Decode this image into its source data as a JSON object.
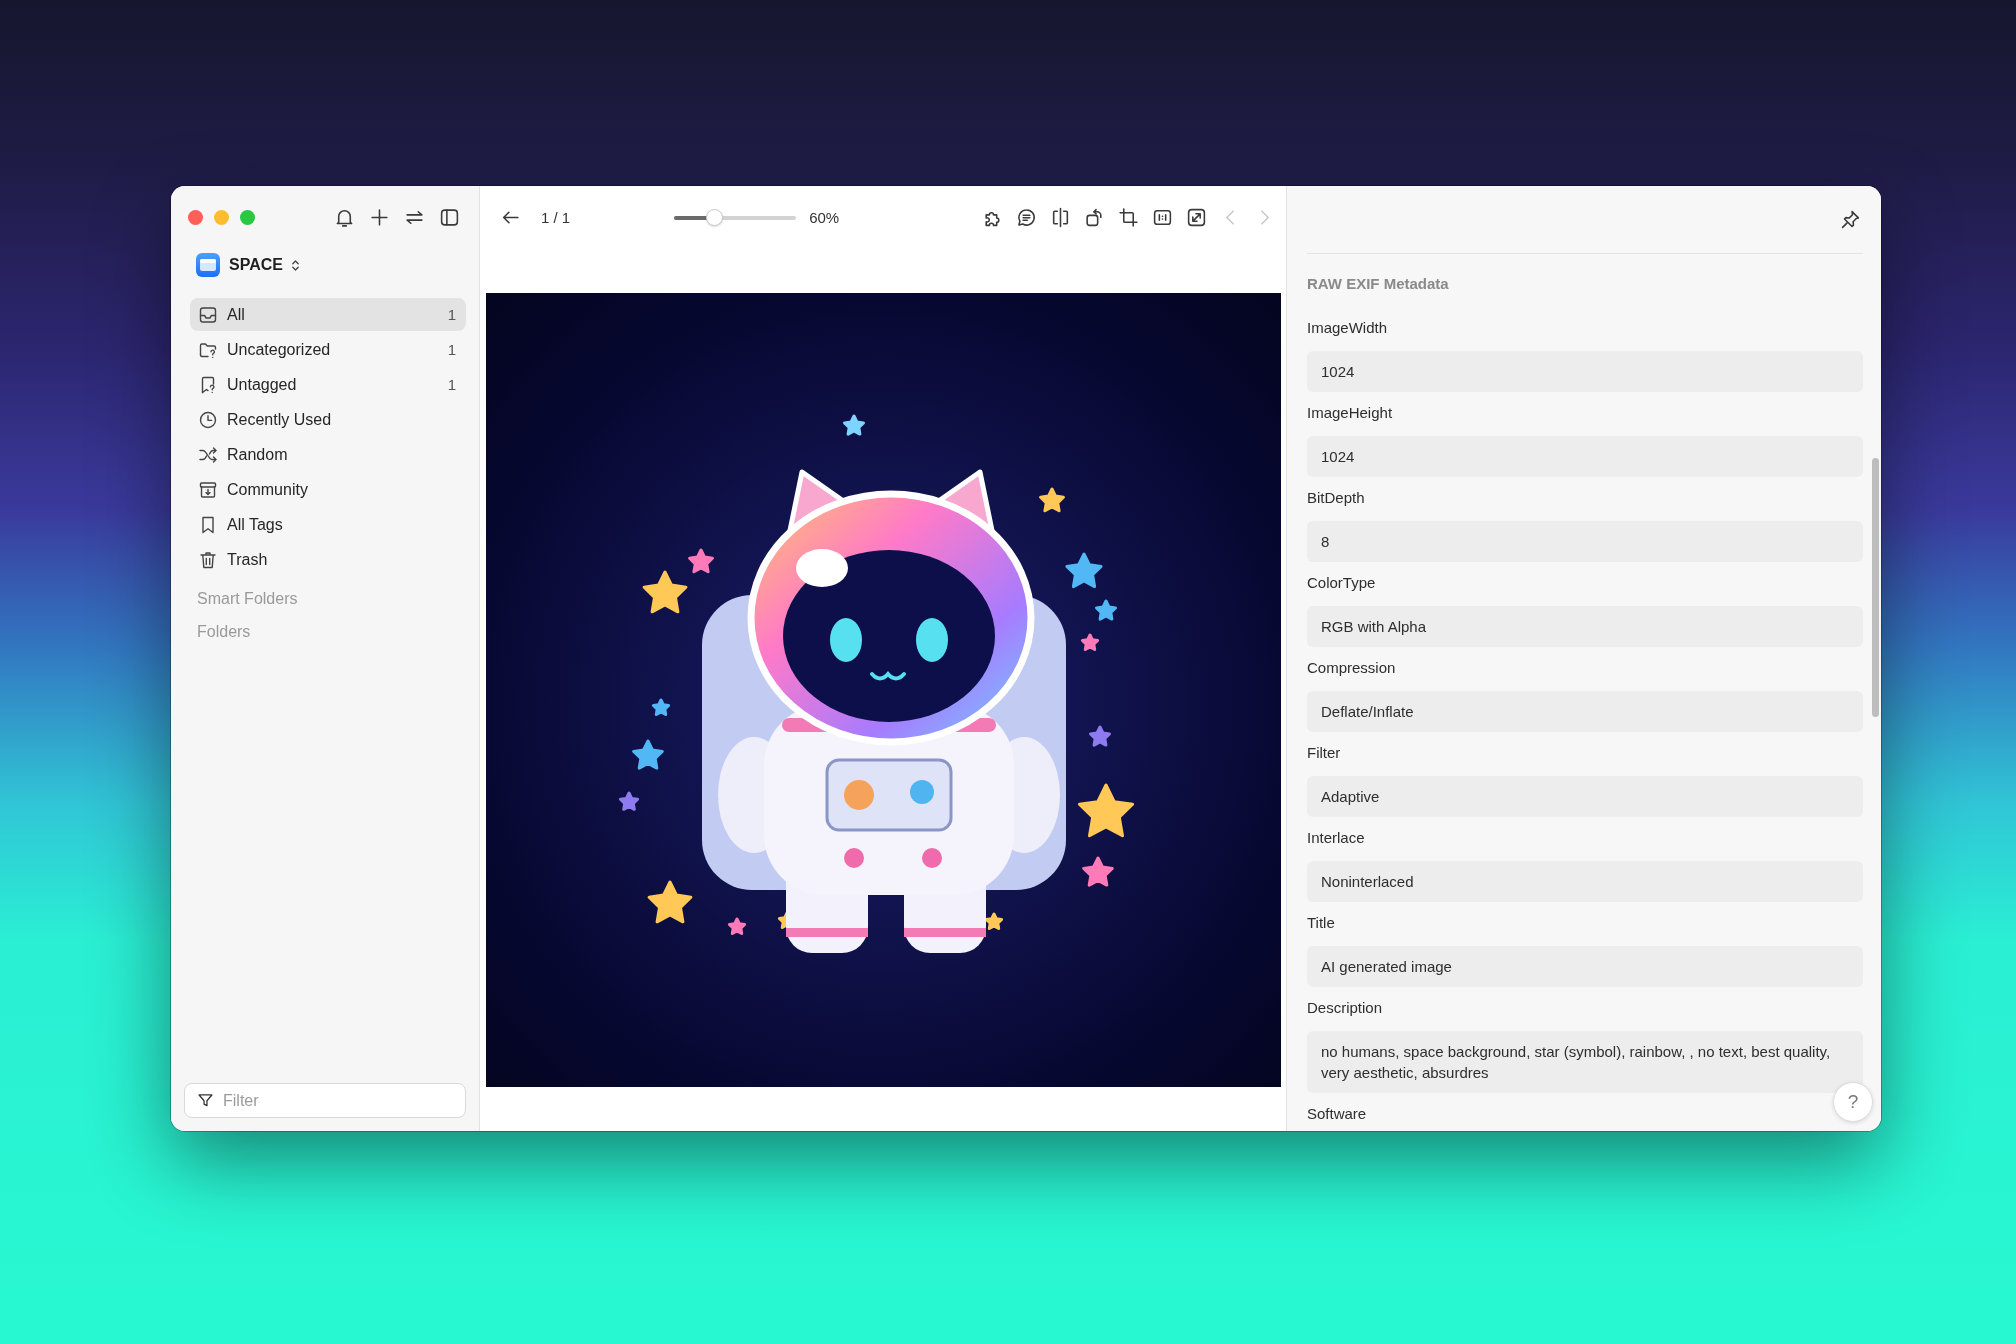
{
  "sidebar": {
    "library": {
      "name": "SPACE"
    },
    "items": [
      {
        "label": "All",
        "count": "1",
        "selected": true
      },
      {
        "label": "Uncategorized",
        "count": "1",
        "selected": false
      },
      {
        "label": "Untagged",
        "count": "1",
        "selected": false
      },
      {
        "label": "Recently Used",
        "selected": false
      },
      {
        "label": "Random",
        "selected": false
      },
      {
        "label": "Community",
        "selected": false
      },
      {
        "label": "All Tags",
        "selected": false
      },
      {
        "label": "Trash",
        "selected": false
      }
    ],
    "sections": [
      "Smart Folders",
      "Folders"
    ],
    "filter": {
      "placeholder": "Filter"
    }
  },
  "viewer": {
    "page": "1 / 1",
    "zoom": {
      "level": 0.33,
      "reading": "60%"
    },
    "previous_button": {
      "disabled": true
    },
    "next_button": {
      "disabled": true
    }
  },
  "inspector": {
    "heading": "RAW EXIF Metadata",
    "fields": [
      {
        "label": "ImageWidth",
        "value": "1024"
      },
      {
        "label": "ImageHeight",
        "value": "1024"
      },
      {
        "label": "BitDepth",
        "value": "8"
      },
      {
        "label": "ColorType",
        "value": "RGB with Alpha"
      },
      {
        "label": "Compression",
        "value": "Deflate/Inflate"
      },
      {
        "label": "Filter",
        "value": "Adaptive"
      },
      {
        "label": "Interlace",
        "value": "Noninterlaced"
      },
      {
        "label": "Title",
        "value": "AI generated image"
      },
      {
        "label": "Description",
        "value": "no humans, space background, star (symbol), rainbow, , no text, best quality, very aesthetic, absurdres"
      },
      {
        "label": "Software"
      }
    ],
    "help_button": {
      "label": "?"
    }
  }
}
